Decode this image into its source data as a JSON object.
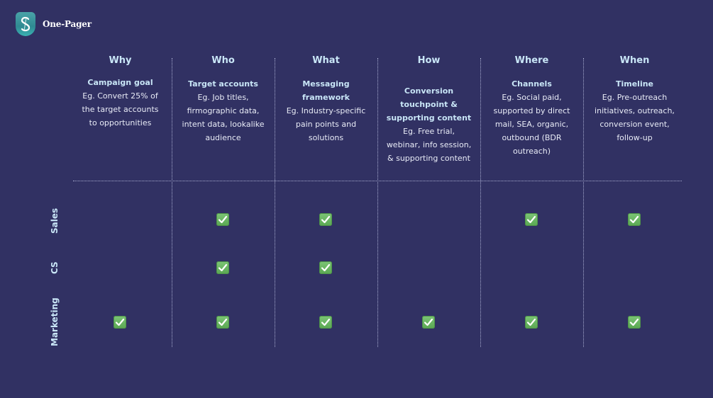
{
  "brand": {
    "name": "One-Pager",
    "logo_icon": "shield-s-logo-icon"
  },
  "columns": [
    {
      "key": "why",
      "title": "Why",
      "subtitle": [
        "Campaign goal"
      ],
      "description": [
        "Eg. Convert 25% of",
        "the target accounts",
        "to opportunities"
      ]
    },
    {
      "key": "who",
      "title": "Who",
      "subtitle": [
        "Target accounts"
      ],
      "description": [
        "Eg. Job titles,",
        "firmographic data,",
        "intent data, lookalike",
        "audience"
      ]
    },
    {
      "key": "what",
      "title": "What",
      "subtitle": [
        "Messaging",
        "framework"
      ],
      "description": [
        "Eg. Industry-specific",
        "pain points and",
        "solutions"
      ]
    },
    {
      "key": "how",
      "title": "How",
      "subtitle": [
        "Conversion",
        "touchpoint &",
        "supporting content"
      ],
      "description": [
        "Eg. Free trial,",
        "webinar, info session,",
        "& supporting content"
      ]
    },
    {
      "key": "where",
      "title": "Where",
      "subtitle": [
        "Channels"
      ],
      "description": [
        "Eg. Social paid,",
        "supported by direct",
        "mail, SEA, organic,",
        "outbound (BDR",
        "outreach)"
      ]
    },
    {
      "key": "when",
      "title": "When",
      "subtitle": [
        "Timeline"
      ],
      "description": [
        "Eg. Pre-outreach",
        "initiatives, outreach,",
        "conversion event,",
        "follow-up"
      ]
    }
  ],
  "rows": [
    {
      "label": "Sales",
      "checks": [
        false,
        true,
        true,
        false,
        true,
        true
      ]
    },
    {
      "label": "CS",
      "checks": [
        false,
        true,
        true,
        false,
        false,
        false
      ]
    },
    {
      "label": "Marketing",
      "checks": [
        true,
        true,
        true,
        true,
        true,
        true
      ]
    }
  ],
  "check_icon": "white-check-mark-icon",
  "colors": {
    "background": "#313163",
    "heading": "#c9e6f7",
    "check": "#6bb865"
  }
}
